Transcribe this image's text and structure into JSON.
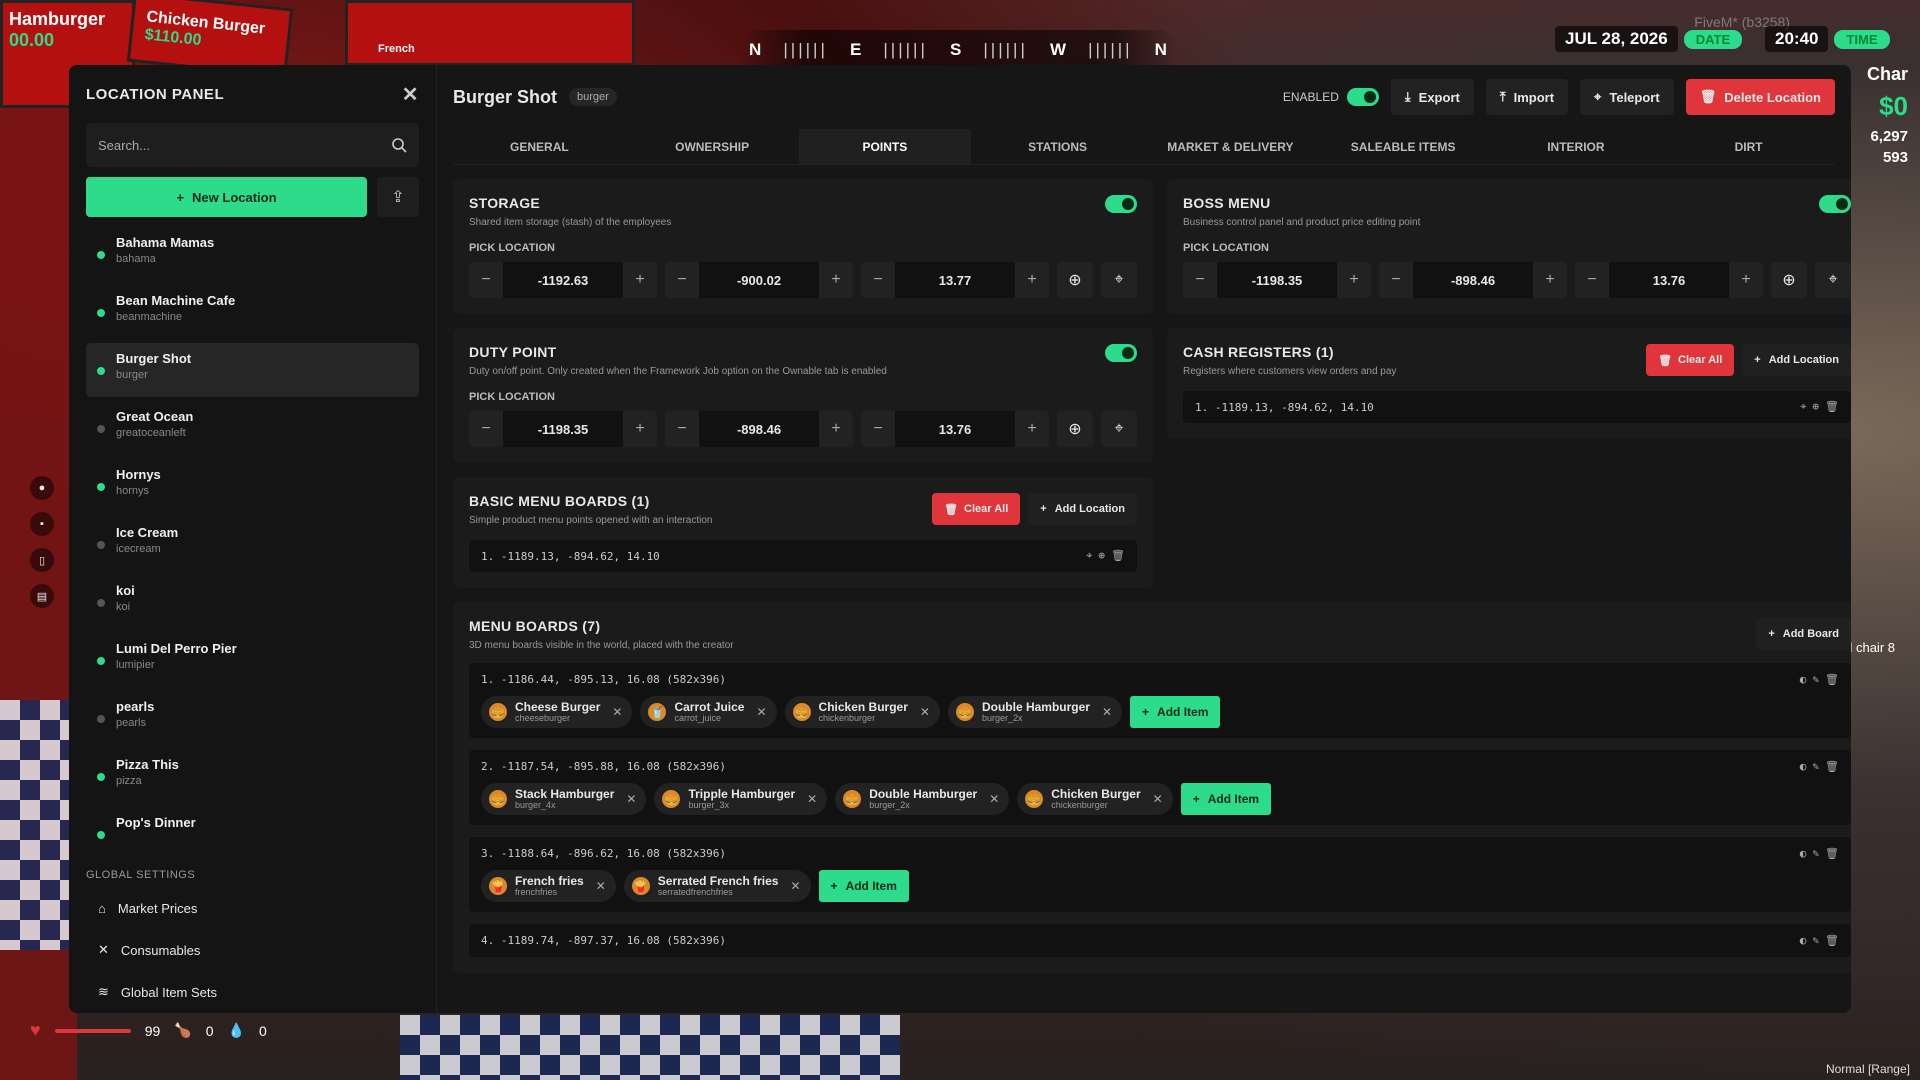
{
  "world": {
    "boards": [
      "Hamburger",
      "00.00",
      "Chicken Burger",
      "$110.00",
      "French"
    ],
    "compass": {
      "letters": [
        "N",
        "E",
        "S",
        "W",
        "N"
      ]
    },
    "date": "JUL 28, 2026",
    "date_label": "DATE",
    "time": "20:40",
    "time_label": "TIME",
    "fivem": "FiveM* (b3258)",
    "char_label": "Char",
    "money": "$0",
    "bank": "6,297",
    "cash": "593",
    "world_text": "l chair 8",
    "health": "99",
    "hunger": "0",
    "thirst": "0",
    "mode": "Normal [Range]"
  },
  "sidebar": {
    "title": "LOCATION PANEL",
    "search_placeholder": "Search...",
    "new_location": "New Location",
    "locations": [
      {
        "name": "Bahama Mamas",
        "slug": "bahama",
        "active": true
      },
      {
        "name": "Bean Machine Cafe",
        "slug": "beanmachine",
        "active": true
      },
      {
        "name": "Burger Shot",
        "slug": "burger",
        "active": true
      },
      {
        "name": "Great Ocean",
        "slug": "greatoceanleft",
        "active": false
      },
      {
        "name": "Hornys",
        "slug": "hornys",
        "active": true
      },
      {
        "name": "Ice Cream",
        "slug": "icecream",
        "active": false
      },
      {
        "name": "koi",
        "slug": "koi",
        "active": false
      },
      {
        "name": "Lumi Del Perro Pier",
        "slug": "lumipier",
        "active": true
      },
      {
        "name": "pearls",
        "slug": "pearls",
        "active": false
      },
      {
        "name": "Pizza This",
        "slug": "pizza",
        "active": true
      },
      {
        "name": "Pop's Dinner",
        "slug": "",
        "active": true
      }
    ],
    "global_settings": "GLOBAL SETTINGS",
    "global_items": [
      "Market Prices",
      "Consumables",
      "Global Item Sets"
    ]
  },
  "header": {
    "title": "Burger Shot",
    "tag": "burger",
    "enabled": "ENABLED",
    "export": "Export",
    "import": "Import",
    "teleport": "Teleport",
    "delete": "Delete Location"
  },
  "tabs": [
    "GENERAL",
    "OWNERSHIP",
    "POINTS",
    "STATIONS",
    "MARKET & DELIVERY",
    "SALEABLE ITEMS",
    "INTERIOR",
    "DIRT"
  ],
  "pick_location": "PICK LOCATION",
  "storage": {
    "title": "STORAGE",
    "desc": "Shared item storage (stash) of the employees",
    "x": "-1192.63",
    "y": "-900.02",
    "z": "13.77"
  },
  "boss": {
    "title": "BOSS MENU",
    "desc": "Business control panel and product price editing point",
    "x": "-1198.35",
    "y": "-898.46",
    "z": "13.76"
  },
  "duty": {
    "title": "DUTY POINT",
    "desc": "Duty on/off point. Only created when the Framework Job option on the Ownable tab is enabled",
    "x": "-1198.35",
    "y": "-898.46",
    "z": "13.76"
  },
  "cash": {
    "title": "CASH REGISTERS (1)",
    "desc": "Registers where customers view orders and pay",
    "clear": "Clear All",
    "add": "Add Location",
    "line": "1. -1189.13, -894.62, 14.10"
  },
  "basic": {
    "title": "BASIC MENU BOARDS (1)",
    "desc": "Simple product menu points opened with an interaction",
    "clear": "Clear All",
    "add": "Add Location",
    "line": "1. -1189.13, -894.62, 14.10"
  },
  "menuboards": {
    "title": "MENU BOARDS (7)",
    "desc": "3D menu boards visible in the world, placed with the creator",
    "add": "Add Board",
    "add_item": "Add Item",
    "boards": [
      {
        "label": "1. -1186.44, -895.13, 16.08 (582x396)",
        "items": [
          {
            "name": "Cheese Burger",
            "id": "cheeseburger"
          },
          {
            "name": "Carrot Juice",
            "id": "carrot_juice"
          },
          {
            "name": "Chicken Burger",
            "id": "chickenburger"
          },
          {
            "name": "Double Hamburger",
            "id": "burger_2x"
          }
        ]
      },
      {
        "label": "2. -1187.54, -895.88, 16.08 (582x396)",
        "items": [
          {
            "name": "Stack Hamburger",
            "id": "burger_4x"
          },
          {
            "name": "Tripple Hamburger",
            "id": "burger_3x"
          },
          {
            "name": "Double Hamburger",
            "id": "burger_2x"
          },
          {
            "name": "Chicken Burger",
            "id": "chickenburger"
          }
        ]
      },
      {
        "label": "3. -1188.64, -896.62, 16.08 (582x396)",
        "items": [
          {
            "name": "French fries",
            "id": "frenchfries"
          },
          {
            "name": "Serrated French fries",
            "id": "serratedfrenchfries"
          }
        ]
      },
      {
        "label": "4. -1189.74, -897.37, 16.08 (582x396)",
        "items": []
      }
    ]
  },
  "colors": {
    "accent": "#2ddc8a",
    "danger": "#e0353a",
    "panel": "#161616"
  }
}
